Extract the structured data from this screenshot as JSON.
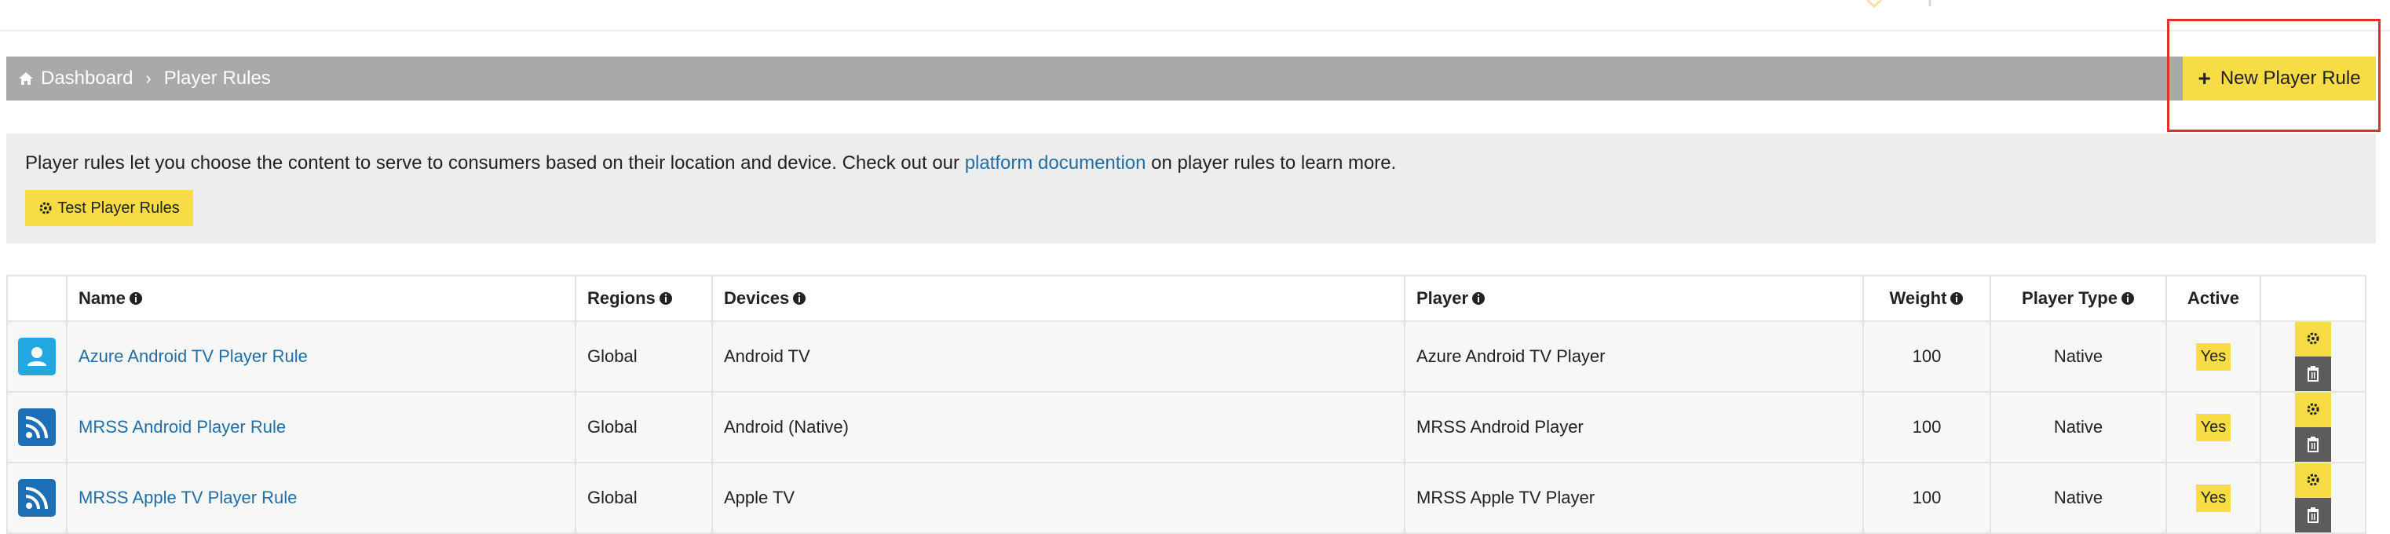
{
  "breadcrumb": {
    "items": [
      "Dashboard",
      "Player Rules"
    ]
  },
  "new_rule_button": "New Player Rule",
  "info_panel": {
    "text_before_link": "Player rules let you choose the content to serve to consumers based on their location and device. Check out our ",
    "link_text": "platform documention",
    "text_after_link": " on player rules to learn more.",
    "test_button": "Test Player Rules"
  },
  "table": {
    "headers": [
      "Name",
      "Regions",
      "Devices",
      "Player",
      "Weight",
      "Player Type",
      "Active"
    ],
    "rows": [
      {
        "icon": "azure-user-icon",
        "name": "Azure Android TV Player Rule",
        "region": "Global",
        "devices": "Android TV",
        "player": "Azure Android TV Player",
        "weight": "100",
        "player_type": "Native",
        "active": "Yes"
      },
      {
        "icon": "rss-feed-icon",
        "name": "MRSS Android Player Rule",
        "region": "Global",
        "devices": "Android (Native)",
        "player": "MRSS Android Player",
        "weight": "100",
        "player_type": "Native",
        "active": "Yes"
      },
      {
        "icon": "rss-feed-icon",
        "name": "MRSS Apple TV Player Rule",
        "region": "Global",
        "devices": "Apple TV",
        "player": "MRSS Apple TV Player",
        "weight": "100",
        "player_type": "Native",
        "active": "Yes"
      }
    ]
  },
  "colors": {
    "accent_yellow": "#f7dc45",
    "breadcrumb_bg": "#a9a9a9",
    "link_blue": "#1f6ea8",
    "highlight_red": "#e0312a",
    "delete_gray": "#5c5c5c"
  }
}
